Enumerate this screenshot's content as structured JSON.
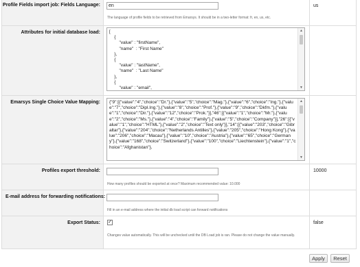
{
  "fields": [
    {
      "label": "Profile Fields import job: Fields Language:",
      "input_value": "en",
      "help": "The language of profile fields to be retrieved from Emarsys. It should be in a two-letter format: fr, en, us, etc.",
      "current": "us"
    },
    {
      "label": "Attributes for initial database load:",
      "textarea": "[\n    {\n        \"value\" : \"firstName\",\n        \"name\"  : \"First Name\"\n    },\n    {\n        \"value\" : \"lastName\",\n        \"name\"  : \"Last Name\"\n    },\n    {\n        \"value\" : \"email\",",
      "current": ""
    },
    {
      "label": "Emarsys Single Choice Value Mapping:",
      "textarea": "{\"9\":[{\"value\":\"4\",\"choice\":\"Dr.\"},{\"value\":\"5\",\"choice\":\"Mag.\"},{\"value\":\"6\",\"choice\":\"Ing.\"},{\"value\":\"7\",\"choice\":\"Dipl.Ing.\"},{\"value\":\"8\",\"choice\":\"Prof.\"},{\"value\":\"9\",\"choice\":\"Dkfm.\"},{\"value\":\"1\",\"choice\":\"Dir.\"},{\"value\":\"12\",\"choice\":\"Prok.\"}],\"46\":[{\"value\":\"1\",\"choice\":\"Mr.\"},{\"value\":\"2\",\"choice\":\"Ms.\"},{\"value\":\"4\",\"choice\":\"Family\"},{\"value\":\"5\",\"choice\":\"Company\"}],\"26\":[{\"value\":\"1\",\"choice\":\"HTML\"},{\"value\":\"2\",\"choice\":\"Text only\"}],\"14\":[{\"value\":\"203\",\"choice\":\"Gibraltar\"},{\"value\":\"204\",\"choice\":\"Netherlands Antilles\"},{\"value\":\"205\",\"choice\":\"Hong Kong\"},{\"value\":\"206\",\"choice\":\"Macau\"},{\"value\":\"10\",\"choice\":\"Austria\"},{\"value\":\"65\",\"choice\":\"Germany\"},{\"value\":\"168\",\"choice\":\"Switzerland\"},{\"value\":\"100\",\"choice\":\"Liechtenstein\"},{\"value\":\"1\",\"choice\":\"Afghanistan\"},",
      "current": ""
    },
    {
      "label": "Profiles export threshold:",
      "input_value": "",
      "help": "How many profiles should be exported at once? Maximum recommended value: 10.000",
      "current": "10000"
    },
    {
      "label": "E-mail address for forwarding notifications:",
      "input_value": "",
      "help": "Fill in an e-mail address where the initial db load script can forward notifications",
      "current": ""
    },
    {
      "label": "Export Status:",
      "checkbox_mark": "✓",
      "help": "Changes value automatically. This will be unchecked until the DB Load job is ran. Please do not change the value manually.",
      "current": "false"
    }
  ],
  "buttons": {
    "apply": "Apply",
    "reset": "Reset"
  },
  "icons": {
    "scroll_up": "scroll-up-arrow-icon",
    "scroll_down": "scroll-down-arrow-icon",
    "checkmark": "checkmark-icon"
  }
}
